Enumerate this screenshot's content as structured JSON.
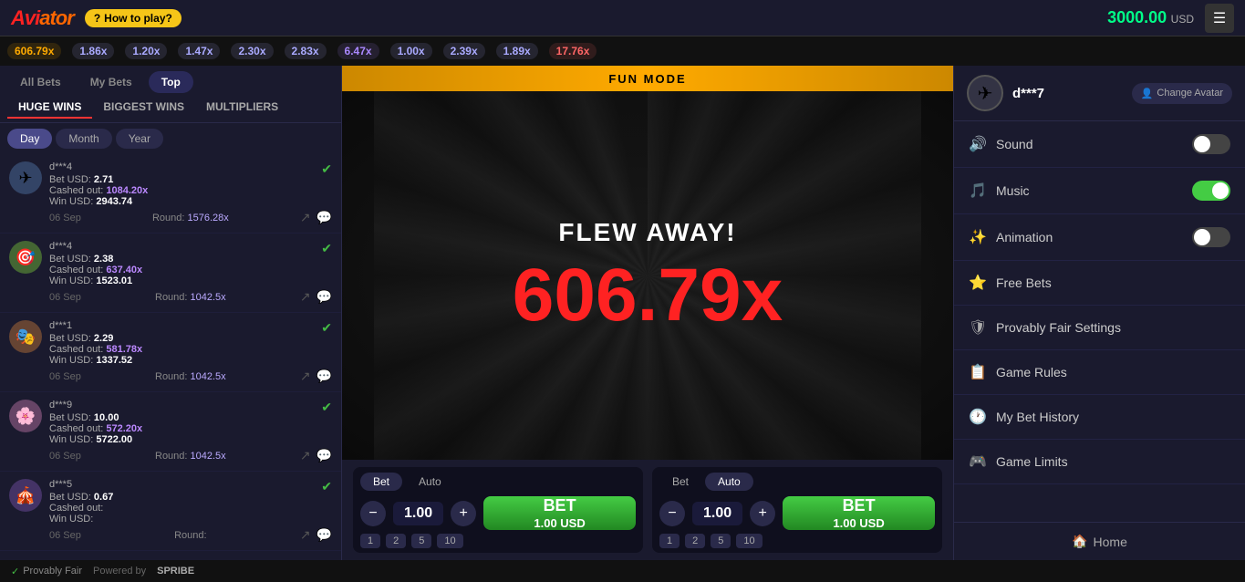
{
  "topbar": {
    "logo": "Aviator",
    "how_to_play": "How to play?",
    "balance": "3000.00",
    "balance_currency": "USD",
    "hamburger": "☰"
  },
  "multiplier_bar": [
    {
      "value": "606.79x",
      "color": "#ffaa00"
    },
    {
      "value": "1.86x",
      "color": "#aaaaff"
    },
    {
      "value": "1.20x",
      "color": "#aaaaff"
    },
    {
      "value": "1.47x",
      "color": "#aaaaff"
    },
    {
      "value": "2.30x",
      "color": "#aaaaff"
    },
    {
      "value": "2.83x",
      "color": "#aaaaff"
    },
    {
      "value": "6.47x",
      "color": "#aa88ff"
    },
    {
      "value": "1.00x",
      "color": "#aaaaff"
    },
    {
      "value": "2.39x",
      "color": "#aaaaff"
    },
    {
      "value": "1.89x",
      "color": "#aaaaff"
    },
    {
      "value": "17.76x",
      "color": "#ff6666"
    }
  ],
  "left_panel": {
    "tabs": [
      "All Bets",
      "My Bets",
      "Top"
    ],
    "active_tab": "Top",
    "sub_tabs": [
      "HUGE WINS",
      "BIGGEST WINS",
      "MULTIPLIERS"
    ],
    "active_sub_tab": "HUGE WINS",
    "periods": [
      "Day",
      "Month",
      "Year"
    ],
    "active_period": "Day",
    "bets": [
      {
        "avatar": "✈",
        "avatar_bg": "#334466",
        "user": "d***4",
        "bet_label": "Bet USD:",
        "bet_val": "2.71",
        "cashout_label": "Cashed out:",
        "cashout_val": "1084.20x",
        "win_label": "Win USD:",
        "win_val": "2943.74",
        "date": "06 Sep",
        "round_label": "Round:",
        "round_val": "1576.28x",
        "verified": true
      },
      {
        "avatar": "🎯",
        "avatar_bg": "#446633",
        "user": "d***4",
        "bet_label": "Bet USD:",
        "bet_val": "2.38",
        "cashout_label": "Cashed out:",
        "cashout_val": "637.40x",
        "win_label": "Win USD:",
        "win_val": "1523.01",
        "date": "06 Sep",
        "round_label": "Round:",
        "round_val": "1042.5x",
        "verified": true
      },
      {
        "avatar": "🎭",
        "avatar_bg": "#664433",
        "user": "d***1",
        "bet_label": "Bet USD:",
        "bet_val": "2.29",
        "cashout_label": "Cashed out:",
        "cashout_val": "581.78x",
        "win_label": "Win USD:",
        "win_val": "1337.52",
        "date": "06 Sep",
        "round_label": "Round:",
        "round_val": "1042.5x",
        "verified": true
      },
      {
        "avatar": "🌸",
        "avatar_bg": "#664466",
        "user": "d***9",
        "bet_label": "Bet USD:",
        "bet_val": "10.00",
        "cashout_label": "Cashed out:",
        "cashout_val": "572.20x",
        "win_label": "Win USD:",
        "win_val": "5722.00",
        "date": "06 Sep",
        "round_label": "Round:",
        "round_val": "1042.5x",
        "verified": true
      },
      {
        "avatar": "🎪",
        "avatar_bg": "#443366",
        "user": "d***5",
        "bet_label": "Bet USD:",
        "bet_val": "0.67",
        "cashout_label": "Cashed out:",
        "cashout_val": "",
        "win_label": "Win USD:",
        "win_val": "",
        "date": "06 Sep",
        "round_label": "Round:",
        "round_val": "",
        "verified": true
      }
    ]
  },
  "game": {
    "fun_mode_label": "FUN MODE",
    "flew_away": "FLEW AWAY!",
    "multiplier": "606.79x"
  },
  "bet_controls": [
    {
      "tabs": [
        "Bet",
        "Auto"
      ],
      "active_tab": "Bet",
      "amount": "1.00",
      "bet_label": "BET",
      "bet_amount": "1.00 USD",
      "quick": [
        "1",
        "2",
        "5",
        "10"
      ]
    },
    {
      "tabs": [
        "Bet",
        "Auto"
      ],
      "active_tab": "Auto",
      "amount": "1.00",
      "bet_label": "BET",
      "bet_amount": "1.00 USD",
      "quick": [
        "1",
        "2",
        "5",
        "10"
      ]
    }
  ],
  "footer": {
    "provably_fair": "Provably Fair",
    "powered_by": "Powered by",
    "spribe": "SPRIBE"
  },
  "right_panel": {
    "user": {
      "avatar": "✈",
      "username": "d***7",
      "change_avatar": "Change\nAvatar"
    },
    "menu_items": [
      {
        "icon": "🔊",
        "label": "Sound",
        "type": "toggle",
        "state": "off"
      },
      {
        "icon": "🎵",
        "label": "Music",
        "type": "toggle",
        "state": "on"
      },
      {
        "icon": "✨",
        "label": "Animation",
        "type": "toggle",
        "state": "off"
      },
      {
        "icon": "⭐",
        "label": "Free Bets",
        "type": "nav"
      },
      {
        "icon": "🛡",
        "label": "Provably Fair Settings",
        "type": "nav"
      },
      {
        "icon": "📋",
        "label": "Game Rules",
        "type": "nav"
      },
      {
        "icon": "🕐",
        "label": "My Bet History",
        "type": "nav"
      },
      {
        "icon": "🎮",
        "label": "Game Limits",
        "type": "nav"
      }
    ],
    "home_label": "Home"
  }
}
